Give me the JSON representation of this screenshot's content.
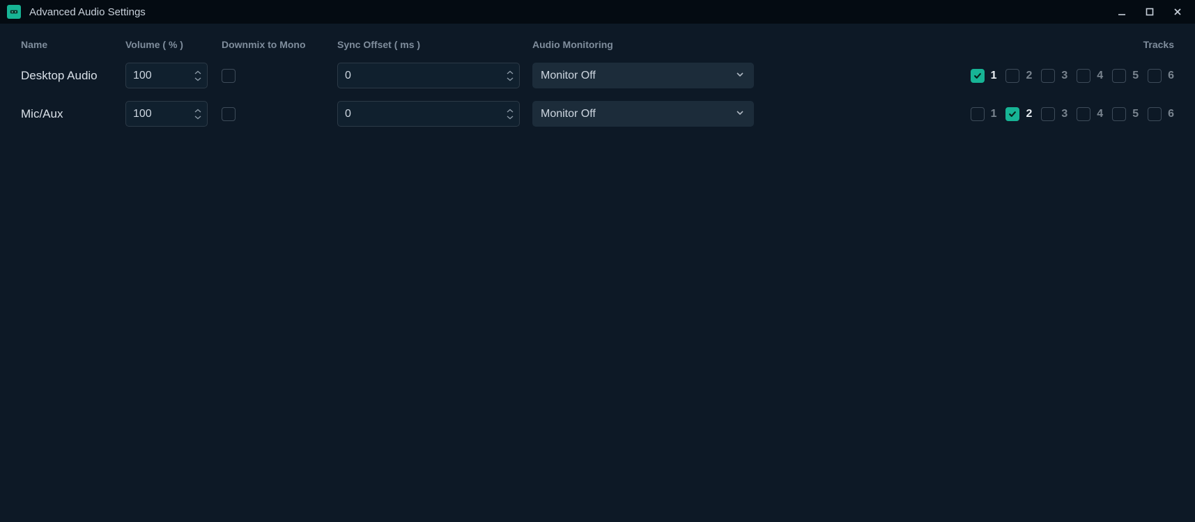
{
  "window": {
    "title": "Advanced Audio Settings"
  },
  "columns": {
    "name": "Name",
    "volume": "Volume ( % )",
    "downmix": "Downmix to Mono",
    "sync": "Sync Offset ( ms )",
    "monitoring": "Audio Monitoring",
    "tracks": "Tracks"
  },
  "track_labels": [
    "1",
    "2",
    "3",
    "4",
    "5",
    "6"
  ],
  "rows": [
    {
      "name": "Desktop Audio",
      "volume": "100",
      "downmix": false,
      "sync": "0",
      "monitoring": "Monitor Off",
      "tracks": [
        true,
        false,
        false,
        false,
        false,
        false
      ]
    },
    {
      "name": "Mic/Aux",
      "volume": "100",
      "downmix": false,
      "sync": "0",
      "monitoring": "Monitor Off",
      "tracks": [
        false,
        true,
        false,
        false,
        false,
        false
      ]
    }
  ],
  "colors": {
    "accent": "#17b495"
  }
}
